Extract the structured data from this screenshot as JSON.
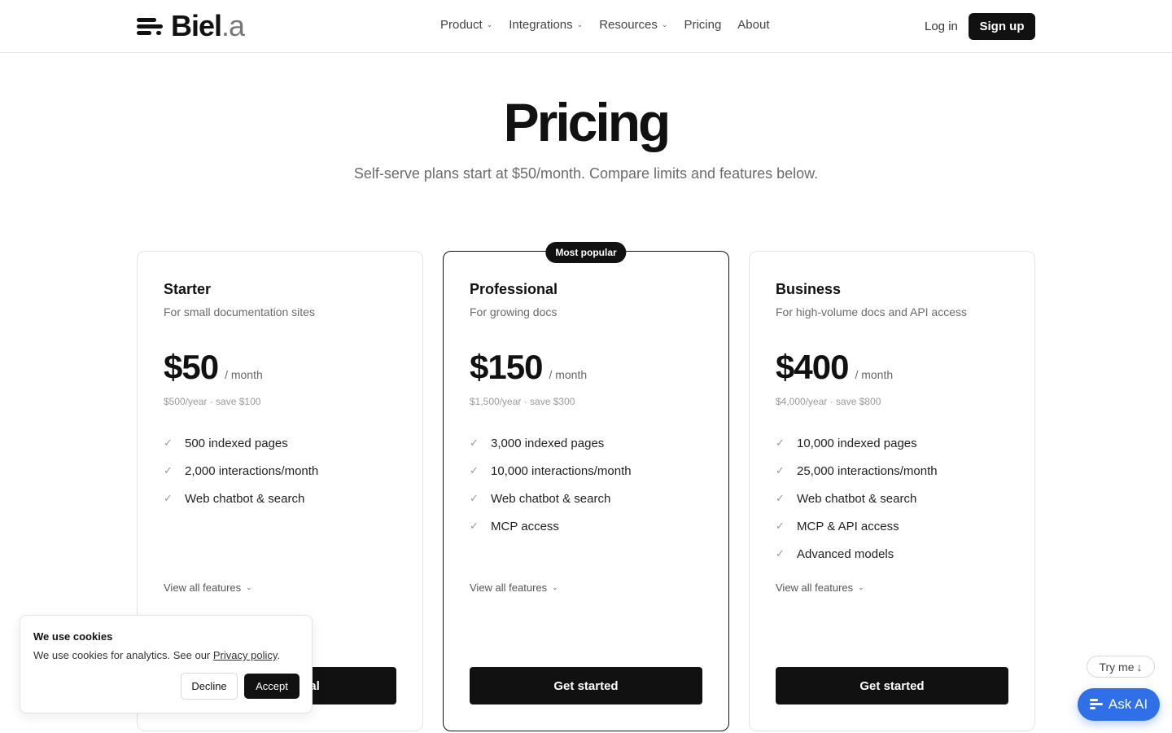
{
  "header": {
    "logo": {
      "name": "Biel",
      "ext": ".a"
    },
    "nav": [
      {
        "label": "Product",
        "has_dropdown": true,
        "icon": "chevron-down-icon"
      },
      {
        "label": "Integrations",
        "has_dropdown": true,
        "icon": "chevron-down-icon"
      },
      {
        "label": "Resources",
        "has_dropdown": true,
        "icon": "chevron-down-icon"
      },
      {
        "label": "Pricing",
        "has_dropdown": false
      },
      {
        "label": "About",
        "has_dropdown": false
      }
    ],
    "login_label": "Log in",
    "signup_label": "Sign up"
  },
  "hero": {
    "title": "Pricing",
    "subtitle": "Self-serve plans start at $50/month. Compare limits and features below."
  },
  "plans": [
    {
      "name": "Starter",
      "description": "For small documentation sites",
      "price": "$50",
      "period": "/ month",
      "annual": "$500/year · save $100",
      "features": [
        "500 indexed pages",
        "2,000 interactions/month",
        "Web chatbot & search"
      ],
      "view_all": "View all features",
      "cta": "Start free trial",
      "featured": false
    },
    {
      "name": "Professional",
      "description": "For growing docs",
      "price": "$150",
      "period": "/ month",
      "annual": "$1,500/year · save $300",
      "features": [
        "3,000 indexed pages",
        "10,000 interactions/month",
        "Web chatbot & search",
        "MCP access"
      ],
      "view_all": "View all features",
      "cta": "Get started",
      "featured": true,
      "badge": "Most popular"
    },
    {
      "name": "Business",
      "description": "For high-volume docs and API access",
      "price": "$400",
      "period": "/ month",
      "annual": "$4,000/year · save $800",
      "features": [
        "10,000 indexed pages",
        "25,000 interactions/month",
        "Web chatbot & search",
        "MCP & API access",
        "Advanced models"
      ],
      "view_all": "View all features",
      "cta": "Get started",
      "featured": false
    }
  ],
  "cookie": {
    "title": "We use cookies",
    "text": "We use cookies for analytics. See our ",
    "link": "Privacy policy",
    "text_end": ".",
    "decline": "Decline",
    "accept": "Accept"
  },
  "widget": {
    "tryme": "Try me",
    "ask_ai": "Ask AI"
  },
  "colors": {
    "accent": "#2f6fe8",
    "primary": "#111111",
    "muted": "#6b6b6b"
  }
}
